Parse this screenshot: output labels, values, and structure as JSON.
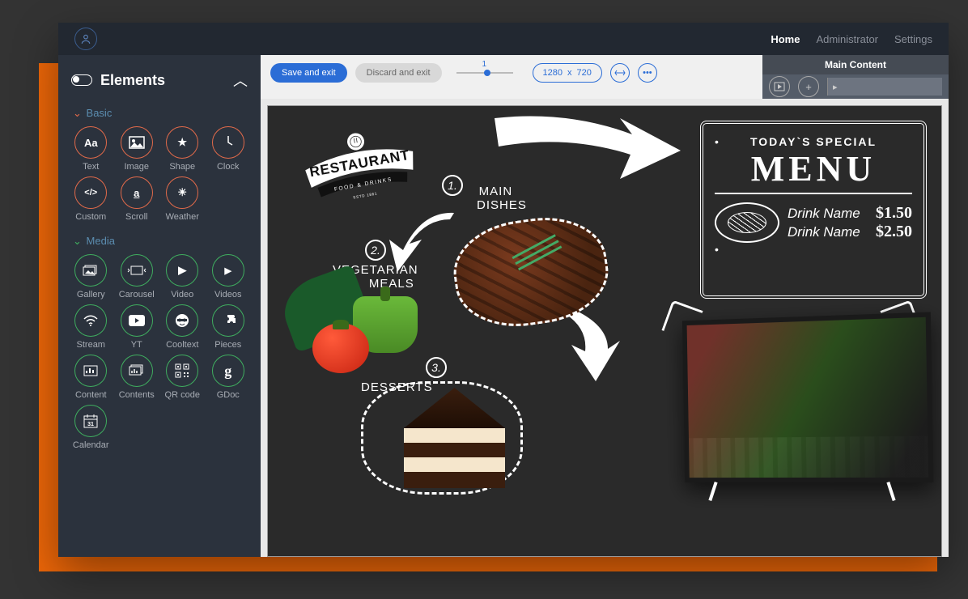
{
  "topnav": {
    "home": "Home",
    "admin": "Administrator",
    "settings": "Settings"
  },
  "sidebar": {
    "title": "Elements",
    "section_basic": "Basic",
    "section_media": "Media",
    "basic": [
      {
        "label": "Text",
        "glyph": "Aa"
      },
      {
        "label": "Image",
        "glyph": "img"
      },
      {
        "label": "Shape",
        "glyph": "star"
      },
      {
        "label": "Clock",
        "glyph": "clock"
      },
      {
        "label": "Custom",
        "glyph": "</>"
      },
      {
        "label": "Scroll",
        "glyph": "a."
      },
      {
        "label": "Weather",
        "glyph": "sun"
      }
    ],
    "media": [
      {
        "label": "Gallery",
        "glyph": "gal"
      },
      {
        "label": "Carousel",
        "glyph": "car"
      },
      {
        "label": "Video",
        "glyph": "play"
      },
      {
        "label": "Videos",
        "glyph": "play2"
      },
      {
        "label": "Stream",
        "glyph": "wifi"
      },
      {
        "label": "YT",
        "glyph": "yt"
      },
      {
        "label": "Cooltext",
        "glyph": "cool"
      },
      {
        "label": "Pieces",
        "glyph": "piece"
      },
      {
        "label": "Content",
        "glyph": "chart"
      },
      {
        "label": "Contents",
        "glyph": "charts"
      },
      {
        "label": "QR code",
        "glyph": "qr"
      },
      {
        "label": "GDoc",
        "glyph": "g"
      },
      {
        "label": "Calendar",
        "glyph": "cal"
      }
    ]
  },
  "toolbar": {
    "save": "Save and exit",
    "discard": "Discard and exit",
    "zoom": "1",
    "width": "1280",
    "x": "x",
    "height": "720"
  },
  "rightpanel": {
    "title": "Main Content",
    "track": "▸"
  },
  "canvas": {
    "banner_top": "RESTAURANT",
    "banner_sub": "FOOD & DRINKS",
    "banner_est": "ESTD 1861",
    "num1": "1.",
    "num2": "2.",
    "num3": "3.",
    "label_main1": "MAIN",
    "label_main2": "DISHES",
    "label_veg1": "VEGETARIAN",
    "label_veg2": "MEALS",
    "label_dessert": "DESSERTS",
    "menu_today": "TODAY`S SPECIAL",
    "menu_title": "MENU",
    "drink1_name": "Drink Name",
    "drink1_price": "$1.50",
    "drink2_name": "Drink Name",
    "drink2_price": "$2.50"
  }
}
